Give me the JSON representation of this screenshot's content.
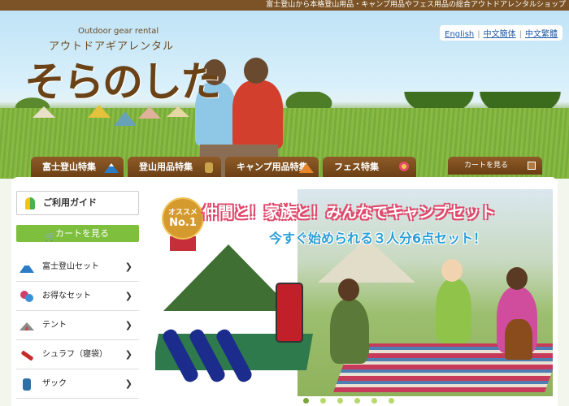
{
  "top_bar": {
    "tagline": "富士登山から本格登山用品・キャンプ用品やフェス用品の総合アウトドアレンタルショップ"
  },
  "logo": {
    "subtitle": "Outdoor gear rental",
    "kana": "アウトドアギアレンタル",
    "main": "そらのした"
  },
  "languages": [
    {
      "label": "English"
    },
    {
      "label": "中文簡体"
    },
    {
      "label": "中文繁體"
    }
  ],
  "nav": {
    "tabs": [
      {
        "label": "富士登山特集",
        "icon": "mount-fuji-icon"
      },
      {
        "label": "登山用品特集",
        "icon": "backpack-icon"
      },
      {
        "label": "キャンプ用品特集",
        "icon": "tent-icon"
      },
      {
        "label": "フェス特集",
        "icon": "balloon-icon"
      }
    ],
    "cart": "カートを見る"
  },
  "sidebar": {
    "guide": "ご利用ガイド",
    "cart": "カートを見る",
    "items": [
      {
        "label": "富士登山セット",
        "icon": "mount-fuji-icon",
        "color": "#2a7cc6"
      },
      {
        "label": "お得なセット",
        "icon": "gear-set-icon",
        "color": "#d2406a"
      },
      {
        "label": "テント",
        "icon": "tent-icon",
        "color": "#8a8a8a"
      },
      {
        "label": "シュラフ（寝袋）",
        "icon": "sleeping-bag-icon",
        "color": "#c82a2a"
      },
      {
        "label": "ザック",
        "icon": "backpack-icon",
        "color": "#2f6fa8"
      }
    ]
  },
  "banner": {
    "badge_top": "オススメ",
    "badge_main": "No.1",
    "title": "仲間と！家族と！みんなでキャンプセット",
    "subtitle": "今すぐ始められる３人分6点セット！",
    "slides": 6,
    "active_slide": 1
  },
  "colors": {
    "brand_brown": "#7b5326",
    "accent_green": "#7fbf3e",
    "title_pink": "#e0486b",
    "subtitle_blue": "#2b9fd6"
  }
}
